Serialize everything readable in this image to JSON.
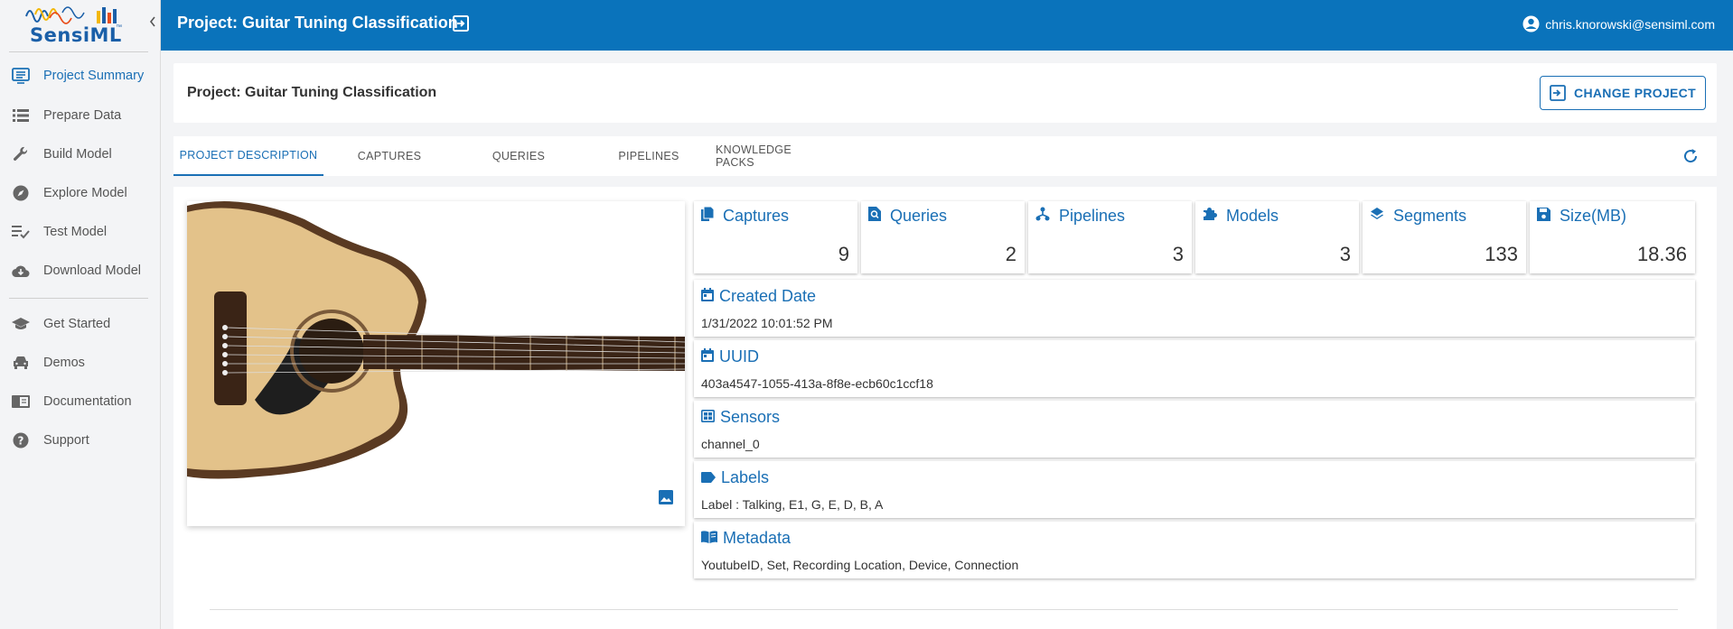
{
  "app": {
    "logo_text": "SensiML",
    "logo_tm": "™"
  },
  "sidebar": {
    "items": [
      {
        "label": "Project Summary",
        "icon": "summary-icon",
        "active": true
      },
      {
        "label": "Prepare Data",
        "icon": "list-icon"
      },
      {
        "label": "Build Model",
        "icon": "wrench-icon"
      },
      {
        "label": "Explore Model",
        "icon": "compass-icon"
      },
      {
        "label": "Test Model",
        "icon": "checklist-icon"
      },
      {
        "label": "Download Model",
        "icon": "cloud-download-icon"
      },
      {
        "label": "Get Started",
        "icon": "graduation-cap-icon"
      },
      {
        "label": "Demos",
        "icon": "car-icon"
      },
      {
        "label": "Documentation",
        "icon": "book-icon"
      },
      {
        "label": "Support",
        "icon": "help-circle-icon"
      }
    ]
  },
  "topbar": {
    "title": "Project: Guitar Tuning Classification",
    "user": "chris.knorowski@sensiml.com"
  },
  "project": {
    "title": "Project: Guitar Tuning Classification",
    "change_label": "CHANGE PROJECT"
  },
  "tabs": [
    {
      "label": "PROJECT DESCRIPTION",
      "active": true
    },
    {
      "label": "CAPTURES"
    },
    {
      "label": "QUERIES"
    },
    {
      "label": "PIPELINES"
    },
    {
      "label": "KNOWLEDGE PACKS"
    }
  ],
  "stats": [
    {
      "label": "Captures",
      "value": "9",
      "icon": "file-copy-icon"
    },
    {
      "label": "Queries",
      "value": "2",
      "icon": "file-search-icon"
    },
    {
      "label": "Pipelines",
      "value": "3",
      "icon": "pipeline-icon"
    },
    {
      "label": "Models",
      "value": "3",
      "icon": "puzzle-icon"
    },
    {
      "label": "Segments",
      "value": "133",
      "icon": "layers-icon"
    },
    {
      "label": "Size(MB)",
      "value": "18.36",
      "icon": "save-icon"
    }
  ],
  "info": [
    {
      "label": "Created Date",
      "value": "1/31/2022 10:01:52 PM",
      "icon": "calendar-icon"
    },
    {
      "label": "UUID",
      "value": "403a4547-1055-413a-8f8e-ecb60c1ccf18",
      "icon": "calendar-icon"
    },
    {
      "label": "Sensors",
      "value": "channel_0",
      "icon": "grid-icon"
    },
    {
      "label": "Labels",
      "value": "Label : Talking, E1, G, E, D, B, A",
      "icon": "label-icon"
    },
    {
      "label": "Metadata",
      "value": "YoutubeID, Set, Recording Location, Device, Connection",
      "icon": "book-open-icon"
    }
  ],
  "colors": {
    "accent": "#1a6fb5",
    "topbar": "#0a73bb",
    "background": "#f3f4f6"
  }
}
